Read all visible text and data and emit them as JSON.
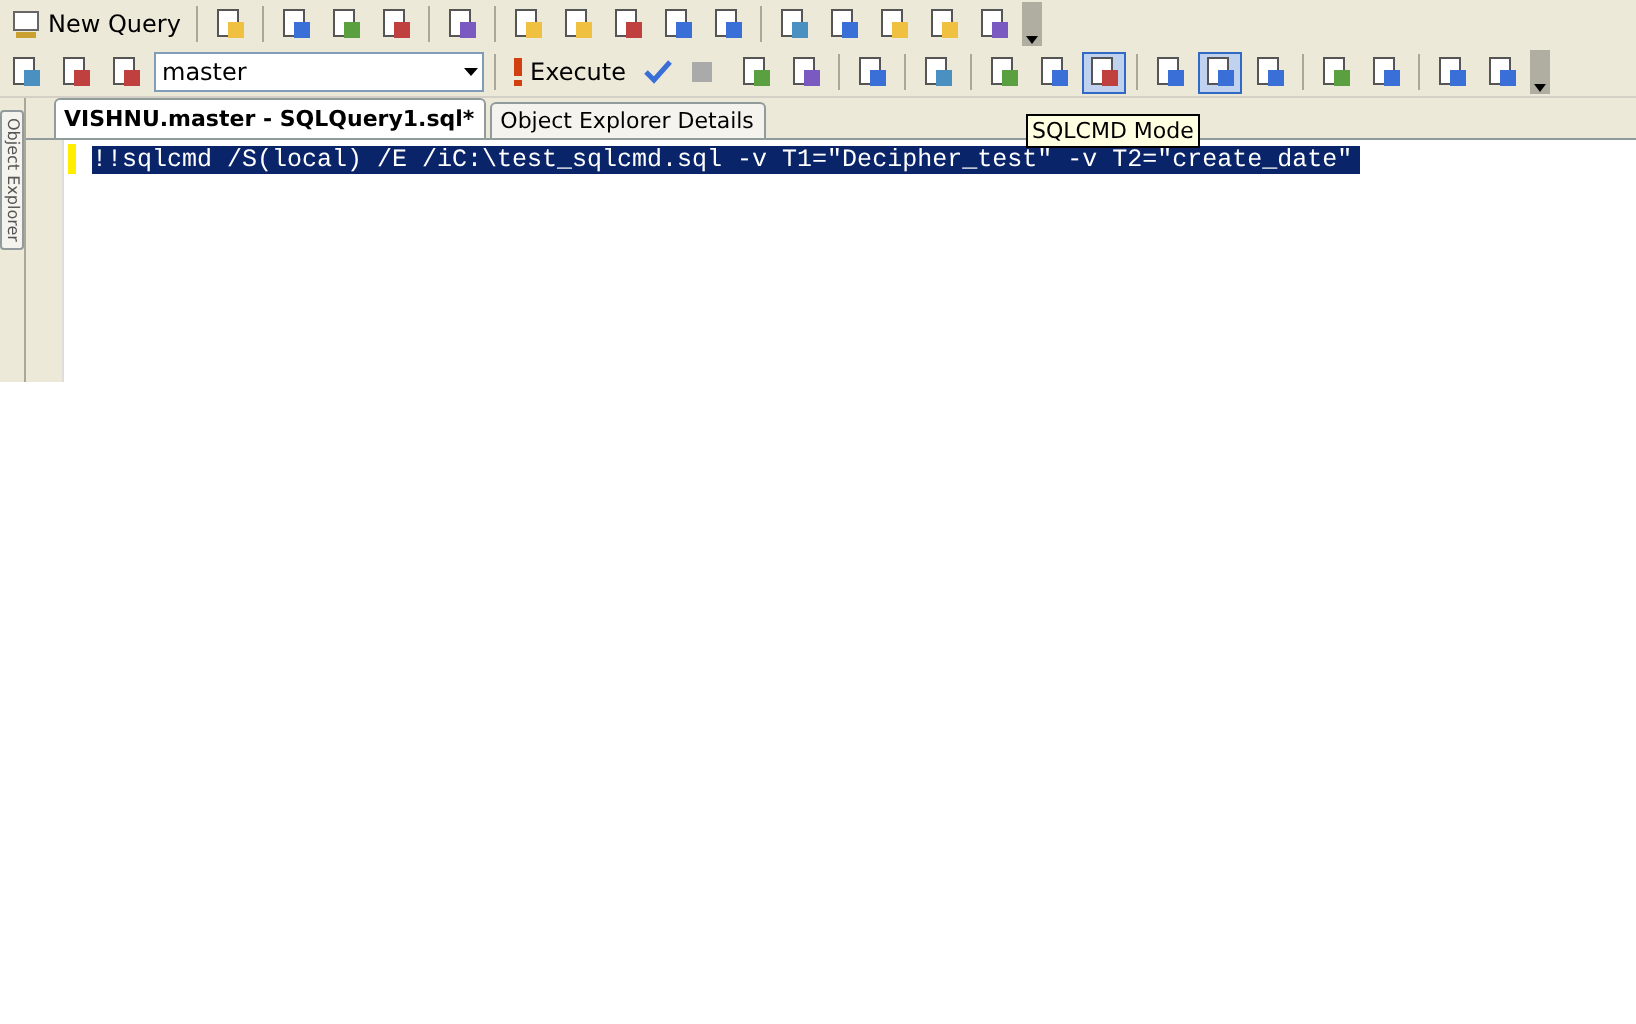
{
  "toolbar": {
    "new_query": "New Query"
  },
  "query_toolbar": {
    "database": "master",
    "execute": "Execute",
    "sqlcmd_mode": {
      "on": true
    },
    "results_to_grid": {
      "on": true
    },
    "tooltip": "SQLCMD Mode"
  },
  "side_panel": {
    "label": "Object Explorer"
  },
  "tabs": [
    {
      "label": "VISHNU.master - SQLQuery1.sql*",
      "selected": true
    },
    {
      "label": "Object Explorer Details",
      "selected": false
    }
  ],
  "editor": {
    "lines": [
      {
        "text": "!!sqlcmd /S(local) /E /iC:\\test_sqlcmd.sql -v T1=\"Decipher_test\" -v T2=\"create_date\"",
        "selected": true
      }
    ]
  }
}
